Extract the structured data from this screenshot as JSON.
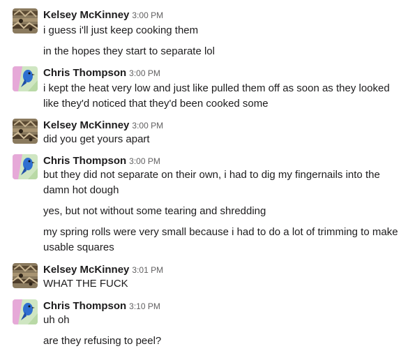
{
  "messages": [
    {
      "author": "Kelsey McKinney",
      "time": "3:00 PM",
      "avatar": "kelsey-avatar",
      "lines": [
        "i guess i'll just keep cooking them",
        "in the hopes they start to separate lol"
      ]
    },
    {
      "author": "Chris Thompson",
      "time": "3:00 PM",
      "avatar": "chris-avatar",
      "lines": [
        "i kept the heat very low and just like pulled them off as soon as they looked like they'd noticed that they'd been cooked some"
      ]
    },
    {
      "author": "Kelsey McKinney",
      "time": "3:00 PM",
      "avatar": "kelsey-avatar",
      "lines": [
        "did you get yours apart"
      ]
    },
    {
      "author": "Chris Thompson",
      "time": "3:00 PM",
      "avatar": "chris-avatar",
      "lines": [
        "but they did not separate on their own, i had to dig my fingernails into the damn hot dough",
        "yes, but not without some tearing and shredding",
        "my spring rolls were very small because i had to do a lot of trimming to make usable squares"
      ]
    },
    {
      "author": "Kelsey McKinney",
      "time": "3:01 PM",
      "avatar": "kelsey-avatar",
      "lines": [
        "WHAT THE FUCK"
      ]
    },
    {
      "author": "Chris Thompson",
      "time": "3:10 PM",
      "avatar": "chris-avatar",
      "lines": [
        "uh oh",
        "are they refusing to peel?"
      ]
    }
  ]
}
